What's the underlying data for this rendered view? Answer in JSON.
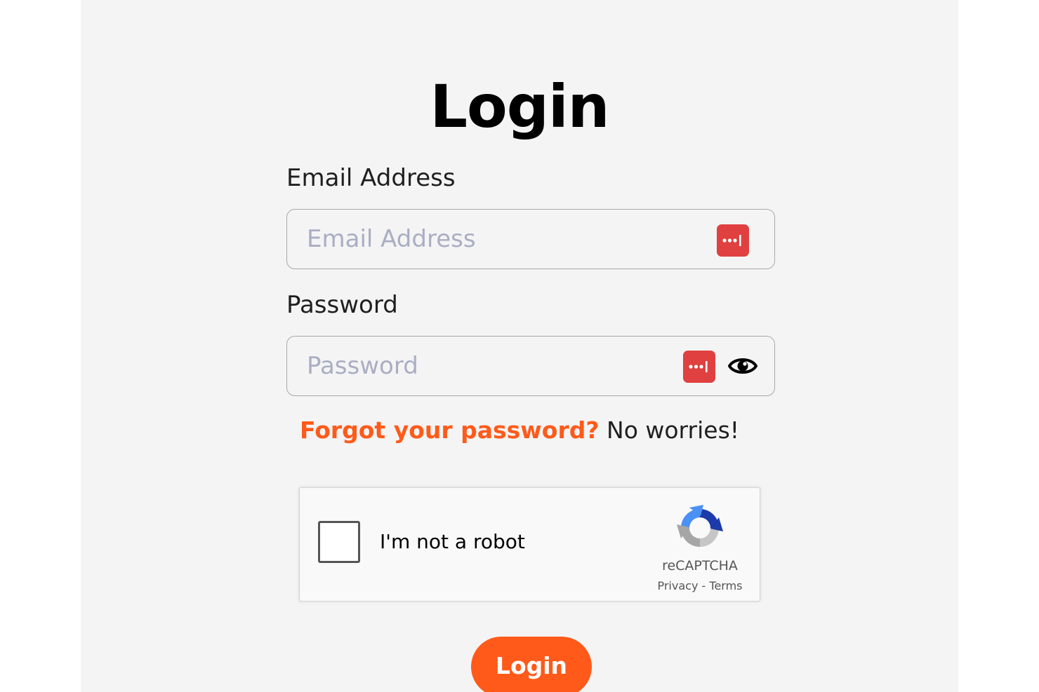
{
  "page": {
    "title": "Login"
  },
  "form": {
    "email": {
      "label": "Email Address",
      "placeholder": "Email Address",
      "value": "",
      "icon": "password-manager-icon"
    },
    "password": {
      "label": "Password",
      "placeholder": "Password",
      "value": "",
      "icon": "password-manager-icon",
      "toggle_icon": "eye-icon"
    },
    "forgot": {
      "link_text": "Forgot your password?",
      "rest_text": "No worries!"
    },
    "captcha": {
      "label": "I'm not a robot",
      "brand": "reCAPTCHA",
      "privacy_label": "Privacy",
      "separator": "-",
      "terms_label": "Terms",
      "icon": "recaptcha-logo-icon"
    },
    "submit_label": "Login"
  },
  "colors": {
    "accent": "#ff5a1a",
    "panel_background": "#f4f4f4",
    "password_manager_badge": "#e04040"
  }
}
